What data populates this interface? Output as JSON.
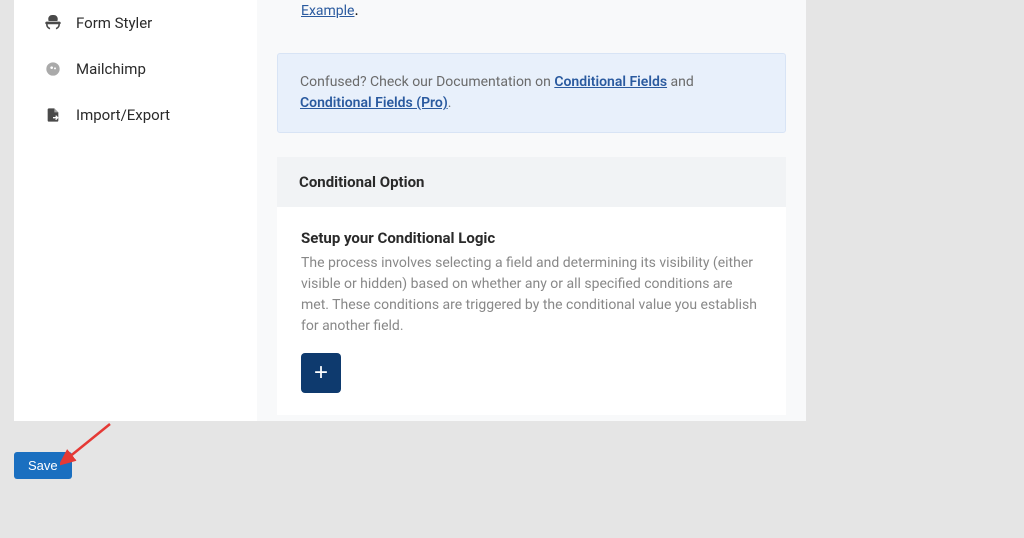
{
  "sidebar": {
    "items": [
      {
        "label": "Form Styler",
        "icon": "mortar"
      },
      {
        "label": "Mailchimp",
        "icon": "mailchimp"
      },
      {
        "label": "Import/Export",
        "icon": "import-export"
      }
    ]
  },
  "main": {
    "example_link": "Example",
    "info": {
      "prefix": "Confused? Check our Documentation on ",
      "link1": "Conditional Fields",
      "middle": " and ",
      "link2": "Conditional Fields (Pro)",
      "suffix": "."
    },
    "section_header": "Conditional Option",
    "section_title": "Setup your Conditional Logic",
    "section_desc": "The process involves selecting a field and determining its visibility (either visible or hidden) based on whether any or all specified conditions are met. These conditions are triggered by the conditional value you establish for another field.",
    "add_label": "+"
  },
  "save_label": "Save"
}
